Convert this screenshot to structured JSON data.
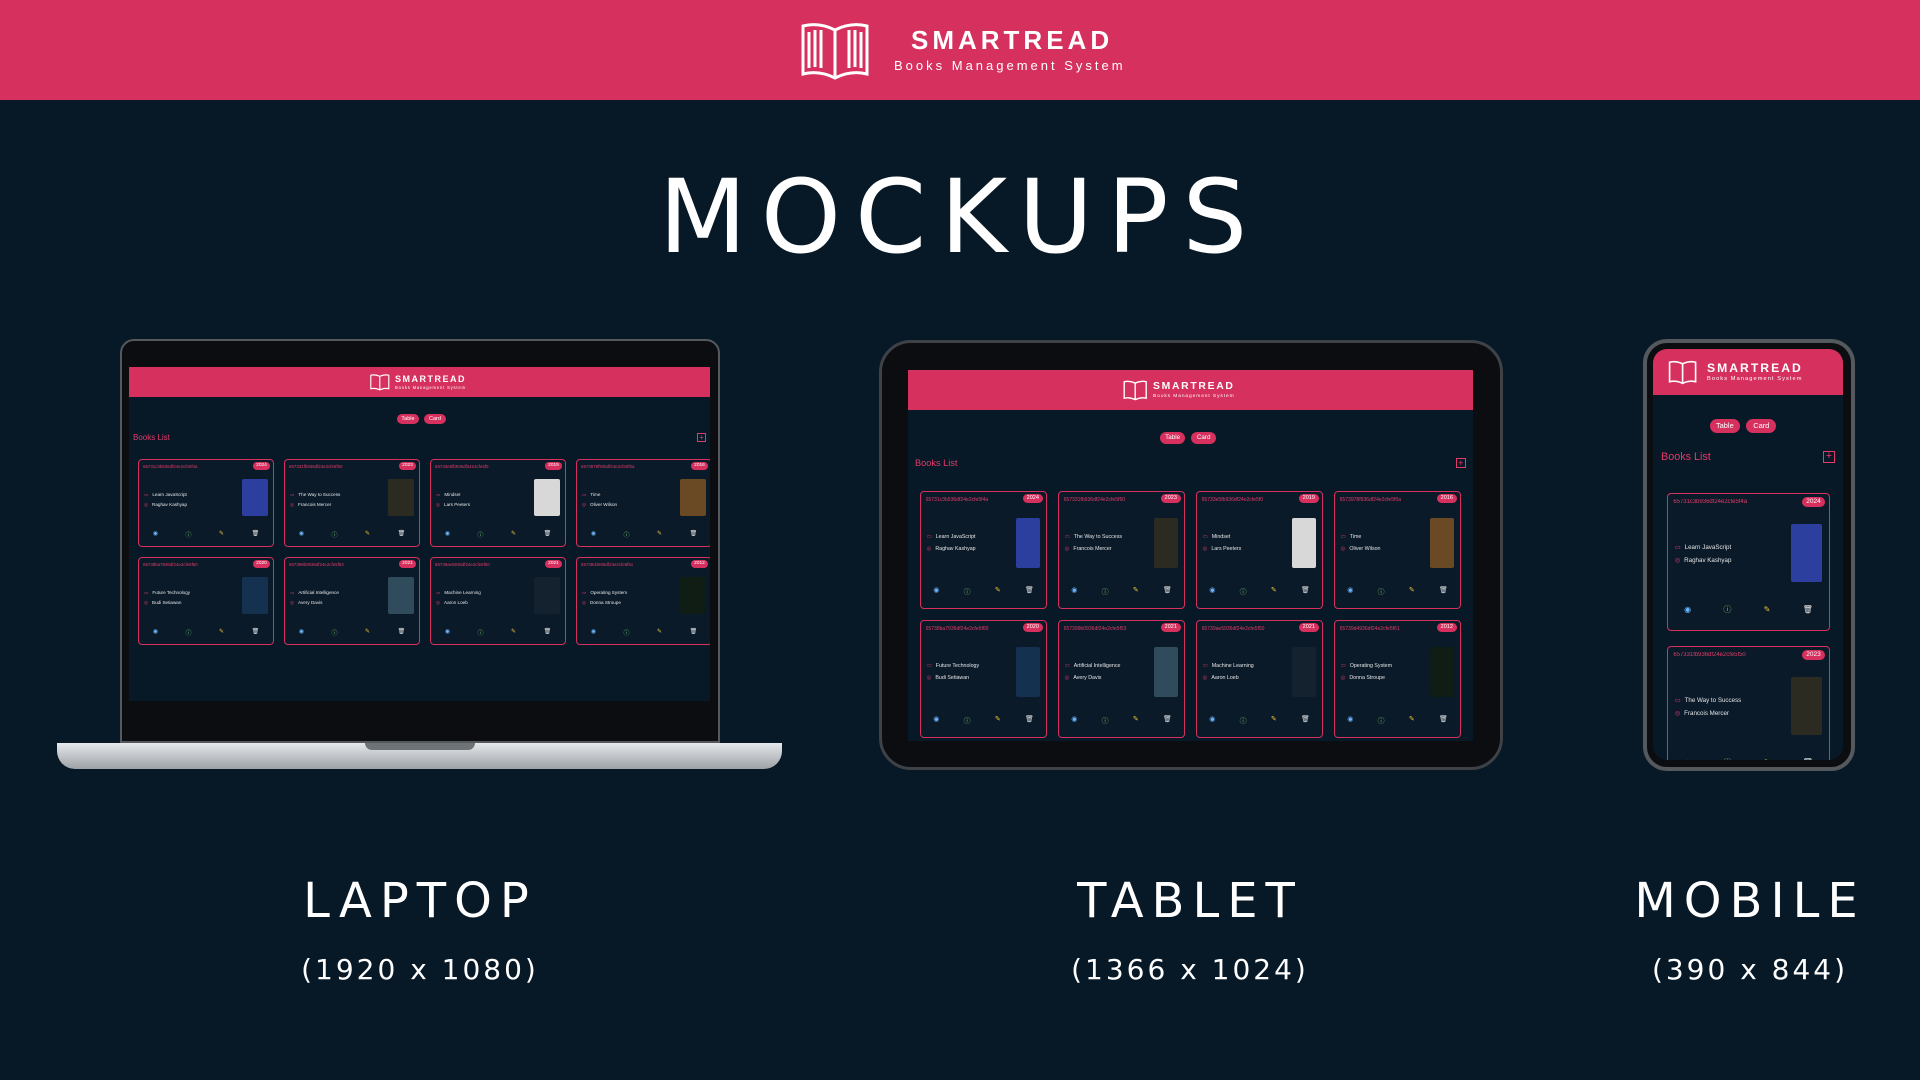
{
  "brand": {
    "title": "SMARTREAD",
    "subtitle": "Books Management System"
  },
  "heading": "MOCKUPS",
  "devices": {
    "laptop": {
      "label": "LAPTOP",
      "size": "(1920 x 1080)"
    },
    "tablet": {
      "label": "TABLET",
      "size": "(1366 x 1024)"
    },
    "mobile": {
      "label": "MOBILE",
      "size": "(390 x 844)"
    }
  },
  "app": {
    "title": "SMARTREAD",
    "subtitle": "Books Management System",
    "toggle": {
      "table": "Table",
      "card": "Card"
    },
    "list_title": "Books List",
    "add_icon": "+",
    "action_icons": [
      "eye-icon",
      "info-icon",
      "edit-icon",
      "trash-icon"
    ],
    "books": [
      {
        "id": "65731c3b936df24e2cfe5f4a",
        "year": "2024",
        "title": "Learn JavaScript",
        "author": "Raghav Kashyap",
        "cover": "#2c3f9e"
      },
      {
        "id": "657331fb936df24e2cfe5f50",
        "year": "2023",
        "title": "The Way to Success",
        "author": "Francois Mercer",
        "cover": "#2b2b22"
      },
      {
        "id": "65733e5fb936df24e2cfe5f0",
        "year": "2019",
        "title": "Mindset",
        "author": "Lars Peeters",
        "cover": "#d8d8d8"
      },
      {
        "id": "6573978f936df24e2cfe5f0a",
        "year": "2016",
        "title": "Time",
        "author": "Oliver Wilson",
        "cover": "#6a4a25"
      },
      {
        "id": "65738ba7936df24e2cfe5f60",
        "year": "2020",
        "title": "Future Technology",
        "author": "Budi Setiawan",
        "cover": "#14324f"
      },
      {
        "id": "657399b0936df24e2cfe5f53",
        "year": "2021",
        "title": "Artificial Intelligence",
        "author": "Avery Davis",
        "cover": "#2f4b5c"
      },
      {
        "id": "65739ae5936df24e2cfe5f50",
        "year": "2021",
        "title": "Machine Learning",
        "author": "Aaron Loeb",
        "cover": "#13222e"
      },
      {
        "id": "65739d4936df24e2cfe5f61",
        "year": "2012",
        "title": "Operating System",
        "author": "Donna Stroupe",
        "cover": "#0f1d14"
      }
    ]
  },
  "colors": {
    "accent": "#d6305e",
    "background": "#071826",
    "card_text": "#e6e6e6"
  }
}
